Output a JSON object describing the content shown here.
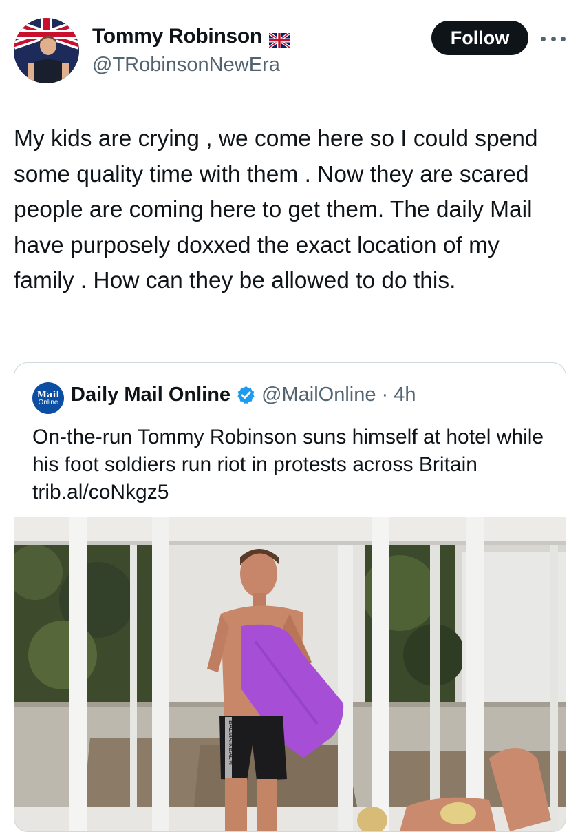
{
  "post": {
    "author": {
      "name": "Tommy Robinson",
      "handle": "@TRobinsonNewEra",
      "flag_icon": "union-jack-flag-icon"
    },
    "follow_label": "Follow",
    "text": "My kids are crying , we come here so I could spend some quality time with them . Now they are scared people are coming here to get them. The daily Mail have purposely doxxed the exact location of my family . How can they be allowed to do this."
  },
  "quote": {
    "avatar": {
      "line1": "Mail",
      "line2": "Online"
    },
    "name": "Daily Mail Online",
    "verified_icon": "verified-badge-icon",
    "handle": "@MailOnline",
    "separator": "·",
    "time": "4h",
    "text": "On-the-run Tommy Robinson suns himself at hotel while his foot soldiers run riot in protests across Britain trib.al/coNkgz5",
    "photo": {
      "shorts_text": "BALMAINBALM"
    }
  },
  "colors": {
    "text_primary": "#0f1419",
    "text_secondary": "#536471",
    "follow_bg": "#0f1419",
    "verified_blue": "#1d9bf0",
    "card_border": "#cfd9de",
    "towel_purple": "#a64fd6"
  }
}
